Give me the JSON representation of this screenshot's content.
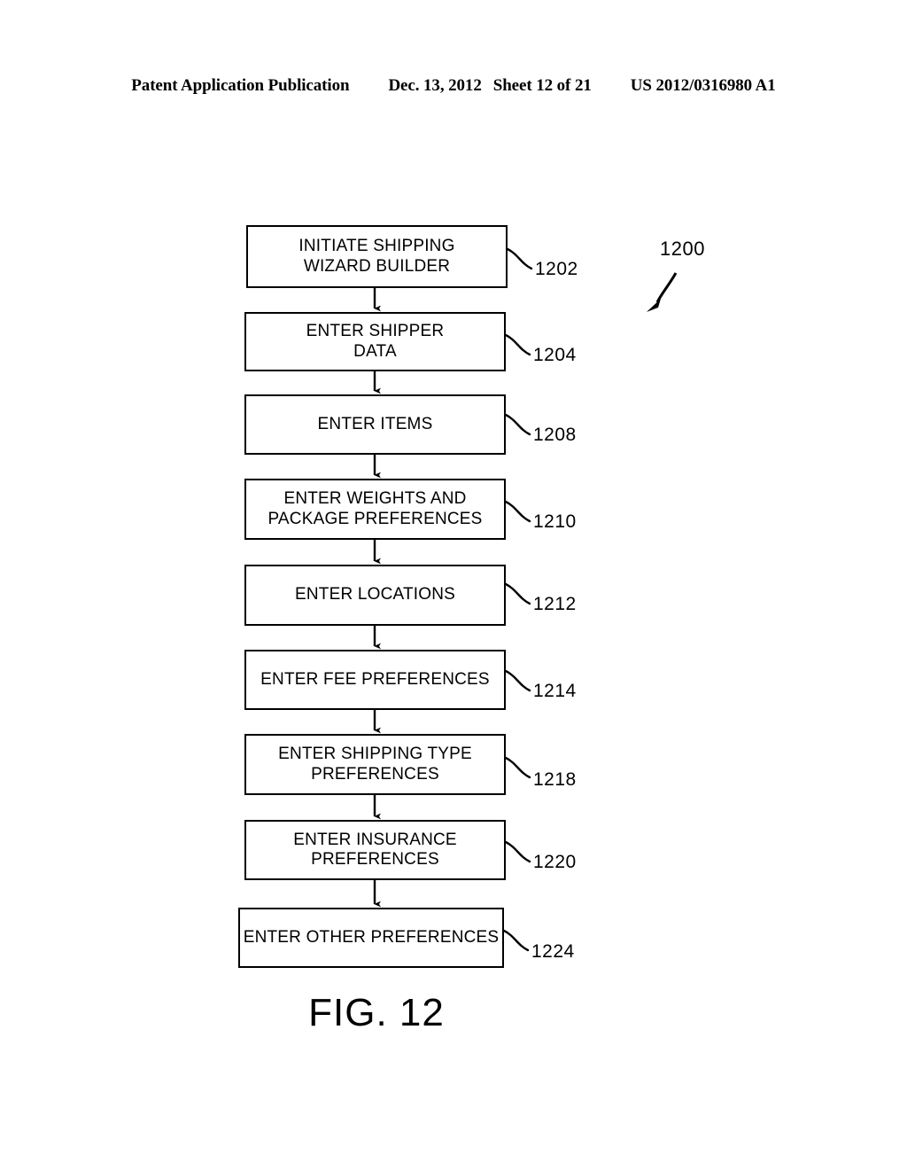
{
  "header": {
    "publication": "Patent Application Publication",
    "date": "Dec. 13, 2012",
    "sheet": "Sheet 12 of 21",
    "patent_number": "US 2012/0316980 A1"
  },
  "figure": {
    "caption": "FIG. 12",
    "diagram_ref": "1200",
    "ink_color": "#000000",
    "background_color": "#ffffff"
  },
  "flowchart": {
    "type": "flowchart",
    "orientation": "top-to-bottom",
    "steps": [
      {
        "ref": "1202",
        "label": "INITIATE SHIPPING\nWIZARD BUILDER"
      },
      {
        "ref": "1204",
        "label": "ENTER SHIPPER\nDATA"
      },
      {
        "ref": "1208",
        "label": "ENTER ITEMS"
      },
      {
        "ref": "1210",
        "label": "ENTER WEIGHTS AND\nPACKAGE PREFERENCES"
      },
      {
        "ref": "1212",
        "label": "ENTER LOCATIONS"
      },
      {
        "ref": "1214",
        "label": "ENTER FEE PREFERENCES"
      },
      {
        "ref": "1218",
        "label": "ENTER SHIPPING TYPE\nPREFERENCES"
      },
      {
        "ref": "1220",
        "label": "ENTER INSURANCE\nPREFERENCES"
      },
      {
        "ref": "1224",
        "label": "ENTER OTHER PREFERENCES"
      }
    ]
  }
}
